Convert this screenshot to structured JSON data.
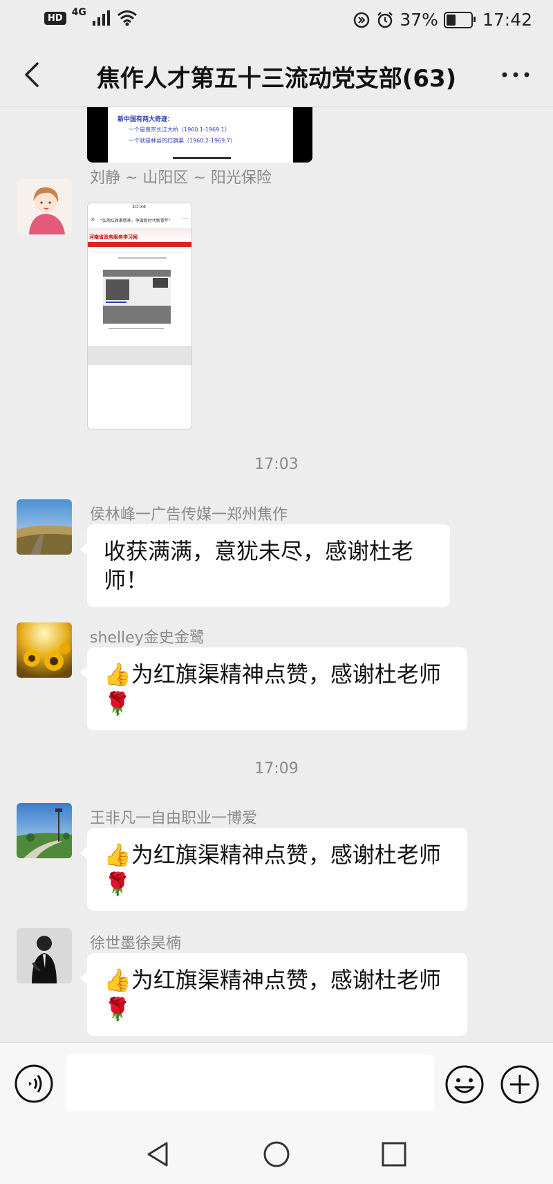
{
  "status_bar": {
    "network": "4G",
    "hd": "HD",
    "battery": "37%",
    "battery_level": 0.37,
    "time": "17:42"
  },
  "header": {
    "title": "焦作人才第五十三流动党支部(63)"
  },
  "partial_image": {
    "line1": "新中国有两大奇迹：",
    "line2": "一个是南京长江大桥（1960.1-1969.1）",
    "line3": "一个就是林县的红旗渠（1960.2-1969.7）"
  },
  "messages": [
    {
      "sender": "刘静 ~ 山阳区 ~ 阳光保险",
      "type": "image"
    },
    {
      "sender": "侯林峰一广告传媒一郑州焦作",
      "text": "收获满满，意犹未尽，感谢杜老师！"
    },
    {
      "sender": "shelley金史金鹭",
      "text": "👍为红旗渠精神点赞，感谢杜老师🌹"
    },
    {
      "sender": "王非凡一自由职业一博爱",
      "text": "👍为红旗渠精神点赞，感谢杜老师🌹"
    },
    {
      "sender": "徐世墨徐昊楠",
      "text": "👍为红旗渠精神点赞，感谢杜老师🌹"
    }
  ],
  "timestamps": [
    "17:03",
    "17:09"
  ],
  "screenshot_thumbnail": {
    "time": "10:34",
    "header": "\"弘扬红旗渠精神，争做新时代新青年\"",
    "banner": "河南省政务服务学习网"
  },
  "input": {
    "placeholder": ""
  },
  "icons": {
    "back": "chevron-left-icon",
    "more": "ellipsis-icon",
    "voice": "voice-icon",
    "emoji": "smiley-icon",
    "plus": "plus-icon"
  }
}
